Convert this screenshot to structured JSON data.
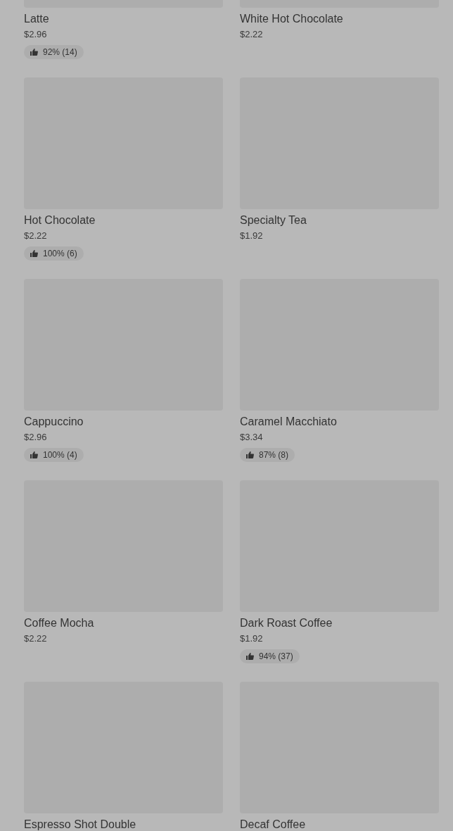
{
  "items": [
    {
      "name": "Latte",
      "price": "$2.96",
      "rating": "92% (14)"
    },
    {
      "name": "White Hot Chocolate",
      "price": "$2.22"
    },
    {
      "name": "Hot Chocolate",
      "price": "$2.22",
      "rating": "100% (6)"
    },
    {
      "name": "Specialty Tea",
      "price": "$1.92"
    },
    {
      "name": "Cappuccino",
      "price": "$2.96",
      "rating": "100% (4)"
    },
    {
      "name": "Caramel Macchiato",
      "price": "$3.34",
      "rating": "87% (8)"
    },
    {
      "name": "Coffee Mocha",
      "price": "$2.22"
    },
    {
      "name": "Dark Roast Coffee",
      "price": "$1.92",
      "rating": "94% (37)"
    },
    {
      "name": "Espresso Shot Double"
    },
    {
      "name": "Decaf Coffee"
    }
  ]
}
